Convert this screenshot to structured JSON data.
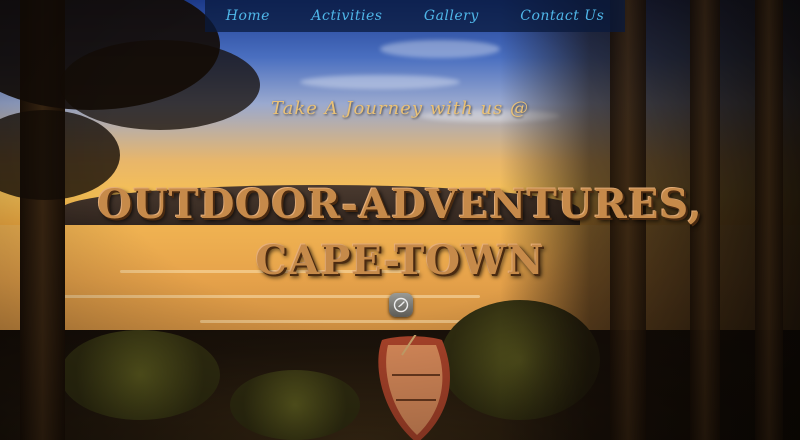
{
  "nav": {
    "items": [
      {
        "label": "Home"
      },
      {
        "label": "Activities"
      },
      {
        "label": "Gallery"
      },
      {
        "label": "Contact Us"
      }
    ]
  },
  "hero": {
    "tagline": "Take A Journey with us @",
    "title_line1": "OUTDOOR-ADVENTURES,",
    "title_line2": "CAPE-TOWN"
  },
  "icons": {
    "scroll_down": "clock-icon"
  },
  "colors": {
    "nav_link": "#4fb6e8",
    "tagline": "#e9c177",
    "title": "#c68a4a"
  }
}
